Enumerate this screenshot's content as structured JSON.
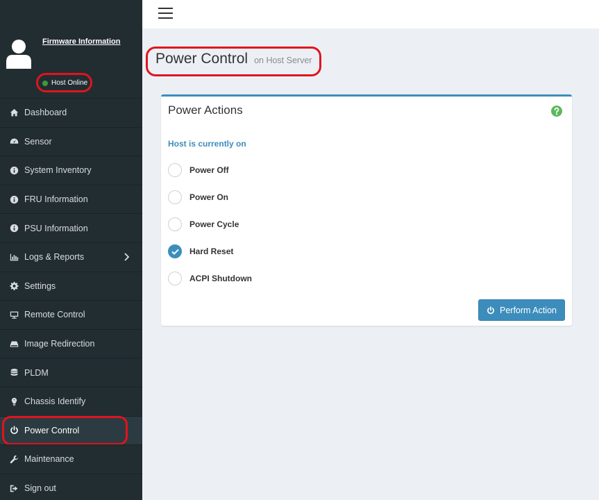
{
  "sidebar": {
    "firmware_link": "Firmware Information",
    "host_status": "Host Online",
    "items": [
      {
        "label": "Dashboard",
        "icon": "home-icon"
      },
      {
        "label": "Sensor",
        "icon": "tachometer-icon"
      },
      {
        "label": "System Inventory",
        "icon": "info-icon"
      },
      {
        "label": "FRU Information",
        "icon": "info-icon"
      },
      {
        "label": "PSU Information",
        "icon": "info-icon"
      },
      {
        "label": "Logs & Reports",
        "icon": "bar-chart-icon"
      },
      {
        "label": "Settings",
        "icon": "gear-icon"
      },
      {
        "label": "Remote Control",
        "icon": "monitor-icon"
      },
      {
        "label": "Image Redirection",
        "icon": "drive-icon"
      },
      {
        "label": "PLDM",
        "icon": "database-icon"
      },
      {
        "label": "Chassis Identify",
        "icon": "lightbulb-icon"
      },
      {
        "label": "Power Control",
        "icon": "power-icon"
      },
      {
        "label": "Maintenance",
        "icon": "wrench-icon"
      },
      {
        "label": "Sign out",
        "icon": "sign-out-icon"
      }
    ]
  },
  "header": {
    "title": "Power Control",
    "subtitle": "on Host Server"
  },
  "panel": {
    "title": "Power Actions",
    "host_state": "Host is currently on",
    "options": [
      "Power Off",
      "Power On",
      "Power Cycle",
      "Hard Reset",
      "ACPI Shutdown"
    ],
    "selected": "Hard Reset",
    "button": "Perform Action"
  },
  "colors": {
    "accent": "#3c8dbc",
    "sidebar_bg": "#222d32",
    "highlight": "#e0141e",
    "status_green": "#3c9a3c",
    "help_green": "#5cb85c"
  }
}
